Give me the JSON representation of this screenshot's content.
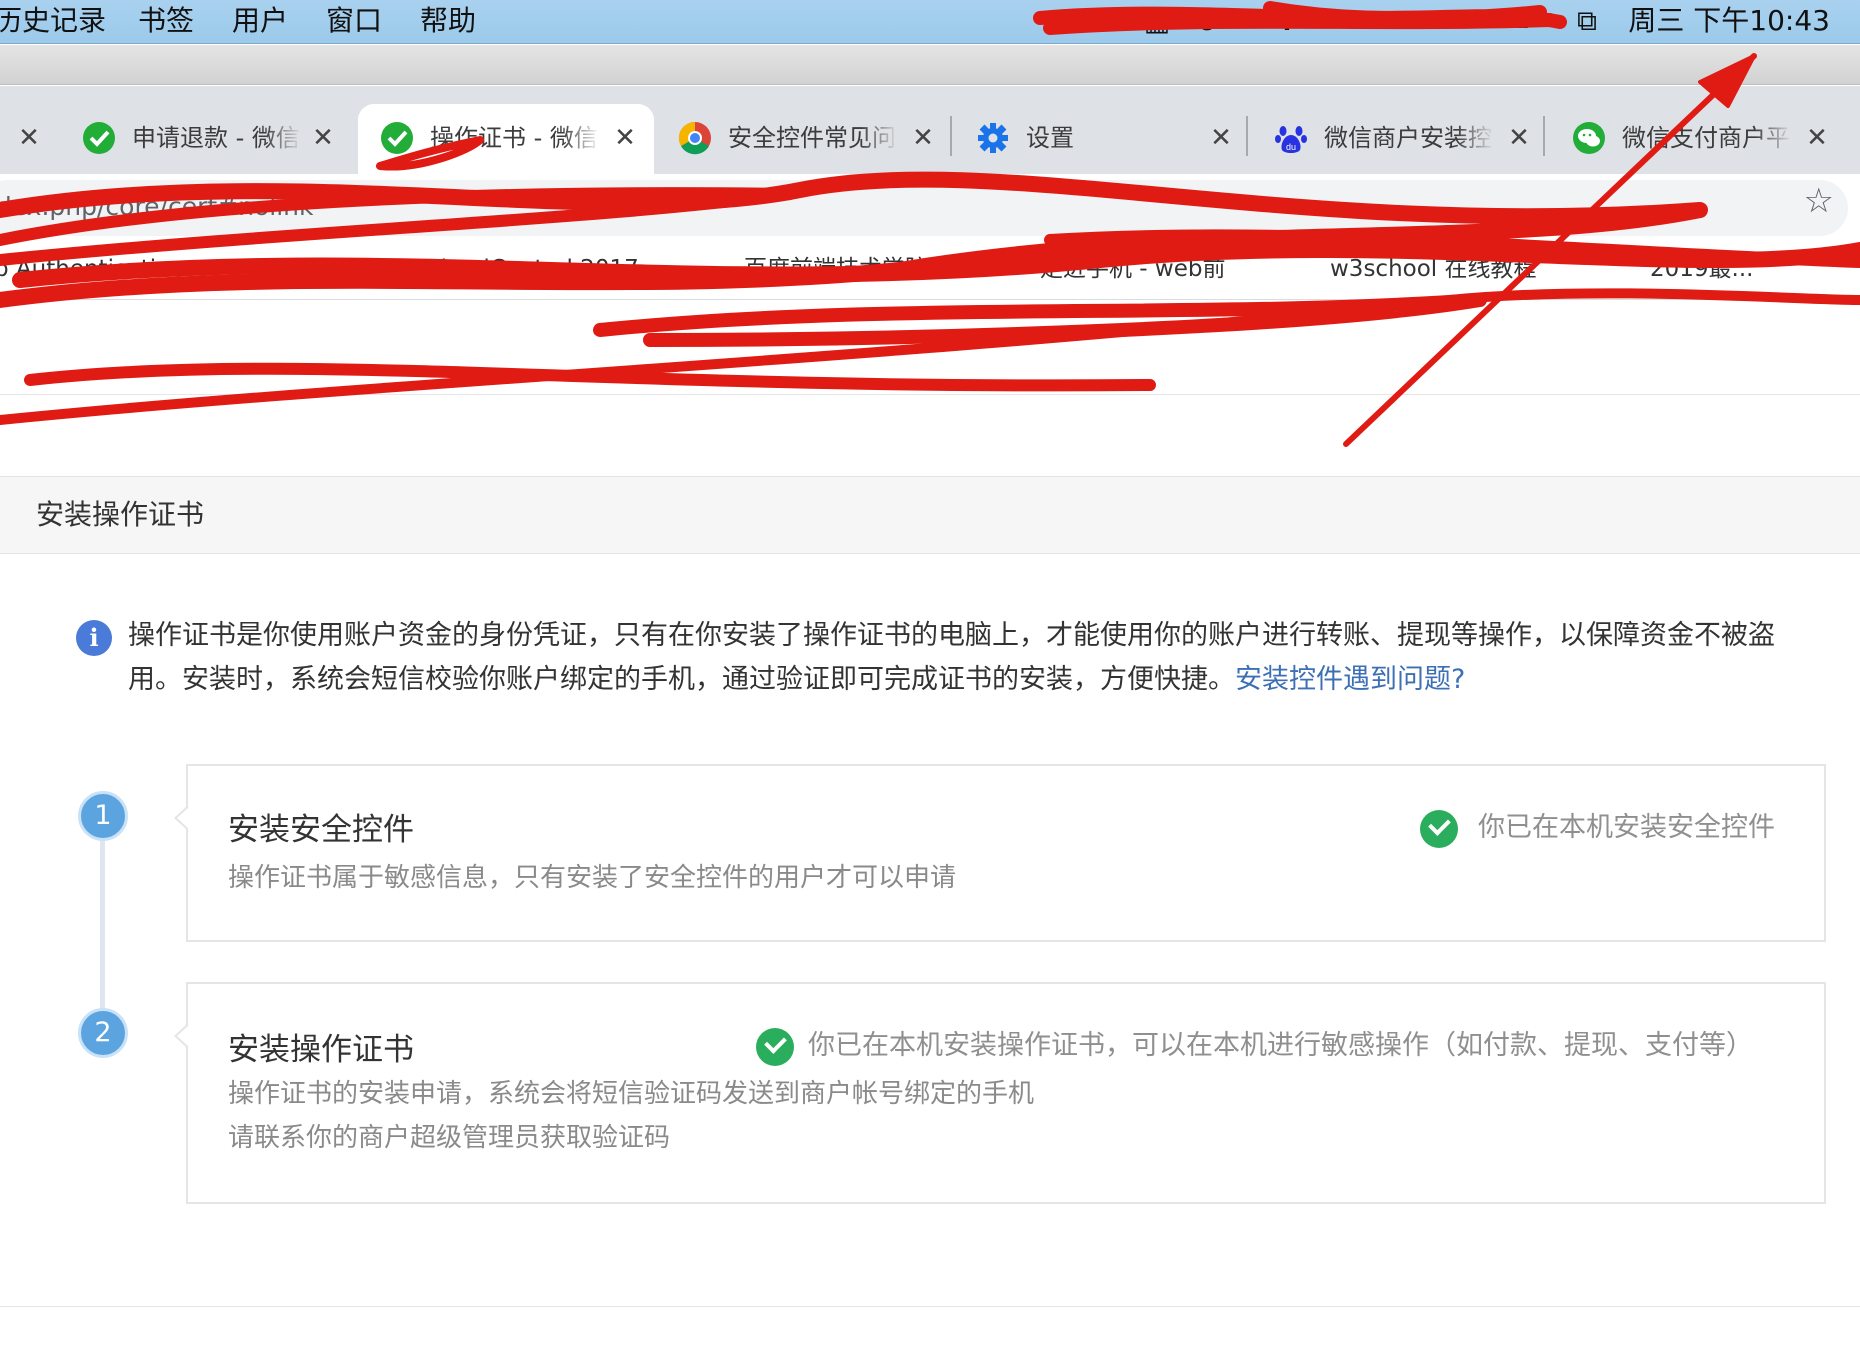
{
  "menubar": {
    "items": [
      "历史记录",
      "书签",
      "用户",
      "窗口",
      "帮助"
    ],
    "clock": "周三 下午10:43",
    "status_icons": [
      "battery-icon",
      "wifi-icon",
      "cloud-icon",
      "grid-icon",
      "bluetooth-icon"
    ]
  },
  "tabs": [
    {
      "title": "申请退款 - 微信",
      "icon": "wechat-pay-icon",
      "active": false
    },
    {
      "title": "操作证书 - 微信",
      "icon": "wechat-pay-icon",
      "active": true
    },
    {
      "title": "安全控件常见问",
      "icon": "chrome-icon",
      "active": false
    },
    {
      "title": "设置",
      "icon": "gear-icon",
      "active": false
    },
    {
      "title": "微信商户安装控",
      "icon": "baidu-icon",
      "active": false
    },
    {
      "title": "微信支付商户平",
      "icon": "wechat-icon",
      "active": false
    }
  ],
  "address": {
    "url": "ndex.php/core/cert#nolink"
  },
  "bookmarks": [
    "p Authenticati",
    "nloadControl 2017",
    "百度前端技术学院",
    "走进手机 - web前",
    "w3school 在线教程",
    "2019最..."
  ],
  "page": {
    "section_title": "安装操作证书",
    "notice": {
      "text": "操作证书是你使用账户资金的身份凭证，只有在你安装了操作证书的电脑上，才能使用你的账户进行转账、提现等操作，以保障资金不被盗用。安装时，系统会短信校验你账户绑定的手机，通过验证即可完成证书的安装，方便快捷。",
      "link": "安装控件遇到问题?"
    },
    "steps": [
      {
        "number": "1",
        "title": "安装安全控件",
        "desc": [
          "操作证书属于敏感信息，只有安装了安全控件的用户才可以申请"
        ],
        "status": "你已在本机安装安全控件"
      },
      {
        "number": "2",
        "title": "安装操作证书",
        "desc": [
          "操作证书的安装申请，系统会将短信验证码发送到商户帐号绑定的手机",
          "请联系你的商户超级管理员获取验证码"
        ],
        "status": "你已在本机安装操作证书，可以在本机进行敏感操作（如付款、提现、支付等）"
      }
    ]
  },
  "colors": {
    "accent": "#3d6fb5",
    "step_circle": "#5ba4e0",
    "success": "#2aae5d",
    "annotation": "#e01b14"
  }
}
